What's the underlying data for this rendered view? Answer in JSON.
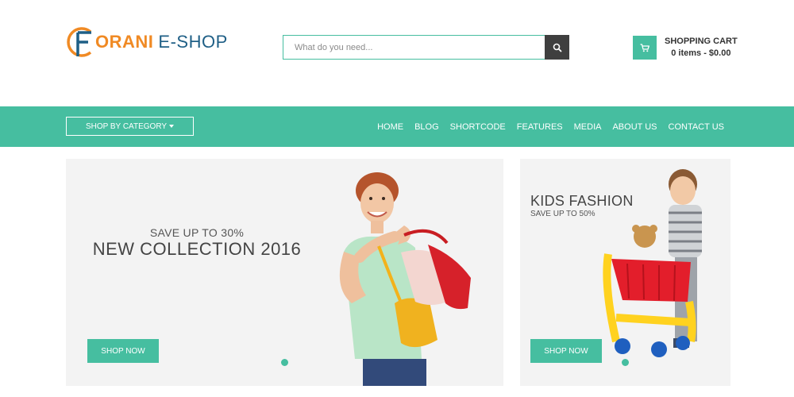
{
  "brand": {
    "logo_letter": "F",
    "name_part1": "ORANI",
    "name_part2": "E-SHOP"
  },
  "search": {
    "placeholder": "What do you need...",
    "value": "",
    "icon": "search-icon"
  },
  "cart": {
    "title": "SHOPPING CART",
    "summary": "0 items - $0.00",
    "icon": "cart-icon"
  },
  "nav": {
    "category_button": "SHOP BY CATEGORY",
    "items": [
      {
        "label": "HOME"
      },
      {
        "label": "BLOG"
      },
      {
        "label": "SHORTCODE"
      },
      {
        "label": "FEATURES"
      },
      {
        "label": "MEDIA"
      },
      {
        "label": "ABOUT US"
      },
      {
        "label": "CONTACT US"
      }
    ]
  },
  "main_banner": {
    "subtitle": "SAVE UP TO 30%",
    "title": "NEW COLLECTION 2016",
    "button": "SHOP NOW",
    "image": "woman-with-shopping-bags"
  },
  "side_banner": {
    "title": "KIDS FASHION",
    "subtitle": "SAVE UP TO 50%",
    "button": "SHOP NOW",
    "image": "child-with-toy-cart"
  },
  "colors": {
    "accent": "#46bea0",
    "logo_orange": "#f08a24",
    "logo_blue": "#1f5f86",
    "search_button": "#3f3f3f",
    "banner_bg": "#f3f3f3"
  }
}
